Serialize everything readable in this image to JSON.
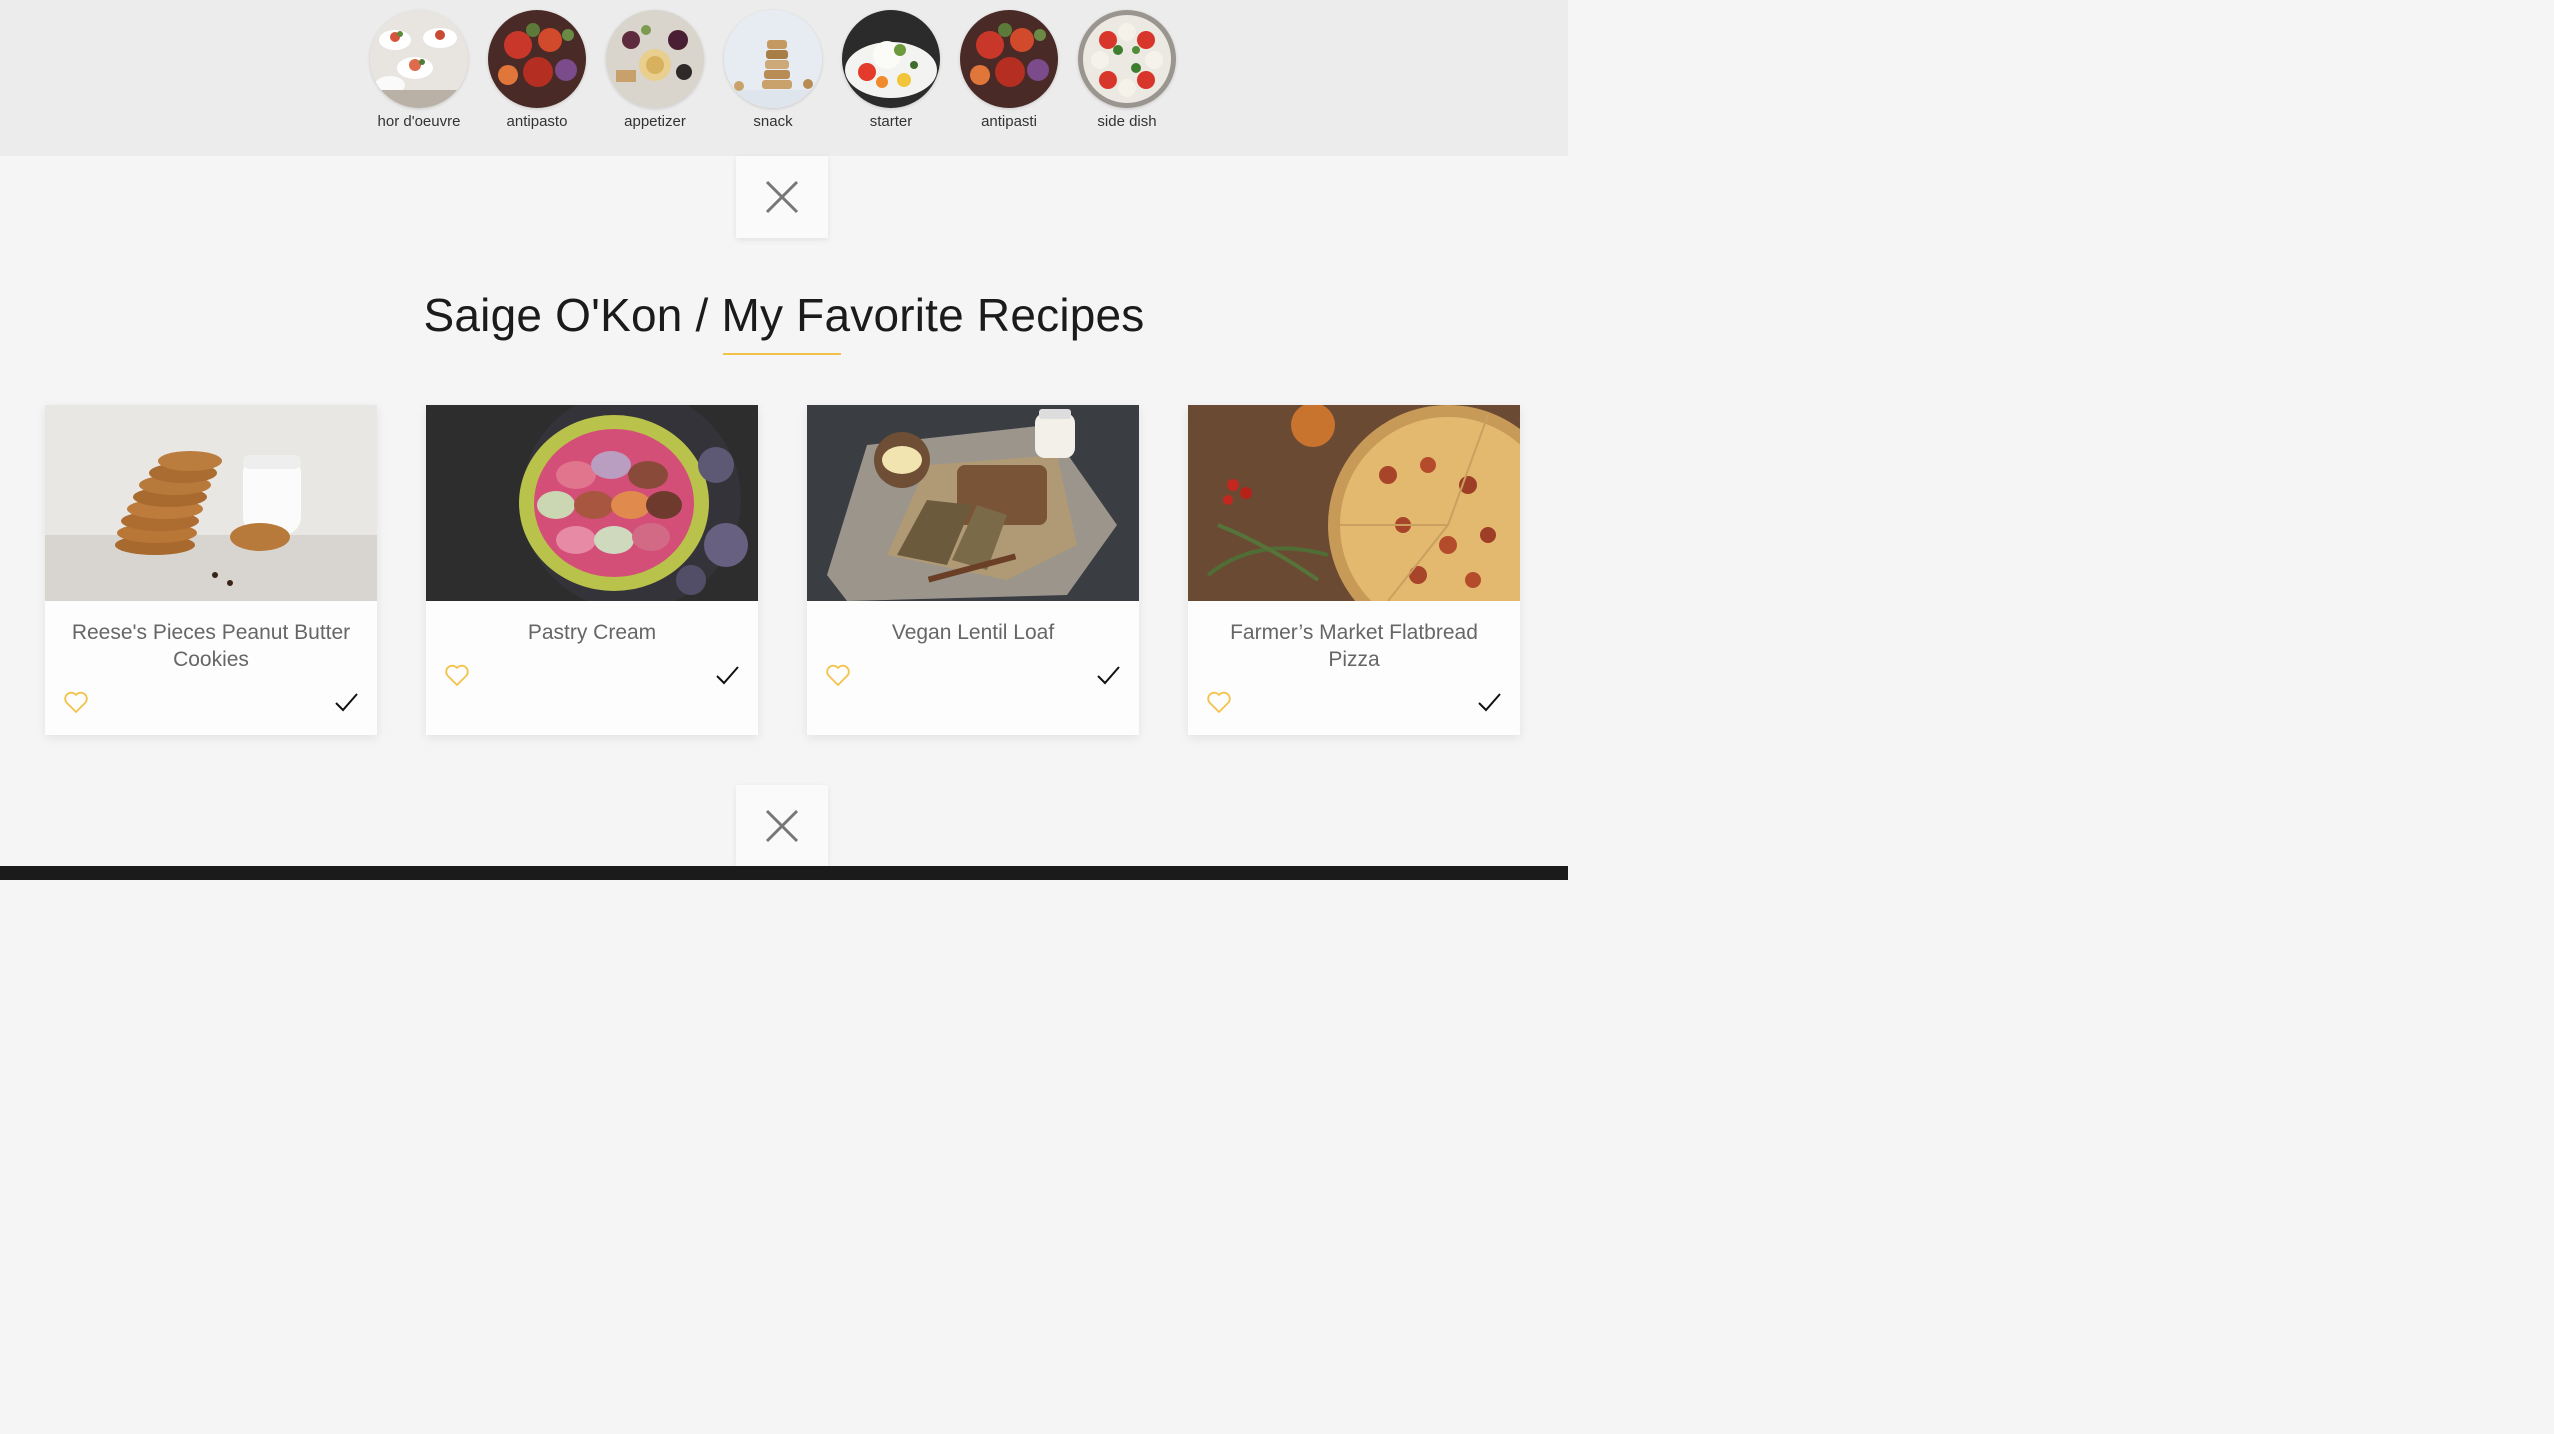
{
  "categories": [
    {
      "label": "hor d'oeuvre",
      "icon": "hors-doeuvre-photo"
    },
    {
      "label": "antipasto",
      "icon": "antipasto-photo"
    },
    {
      "label": "appetizer",
      "icon": "appetizer-photo"
    },
    {
      "label": "snack",
      "icon": "snack-photo"
    },
    {
      "label": "starter",
      "icon": "starter-photo"
    },
    {
      "label": "antipasti",
      "icon": "antipasti-photo"
    },
    {
      "label": "side dish",
      "icon": "side-dish-photo"
    }
  ],
  "page": {
    "title": "Saige O'Kon / My Favorite Recipes",
    "accent_color": "#f2c24b"
  },
  "recipes": [
    {
      "title": "Reese's Pieces Peanut Butter Cookies",
      "image": "cookies-photo"
    },
    {
      "title": "Pastry Cream",
      "image": "macarons-photo"
    },
    {
      "title": "Vegan Lentil Loaf",
      "image": "lentil-loaf-photo"
    },
    {
      "title": "Farmer’s Market Flatbread Pizza",
      "image": "pizza-photo"
    }
  ],
  "icons": {
    "close": "close-icon",
    "favorite": "heart-icon",
    "done": "checkmark-icon"
  }
}
